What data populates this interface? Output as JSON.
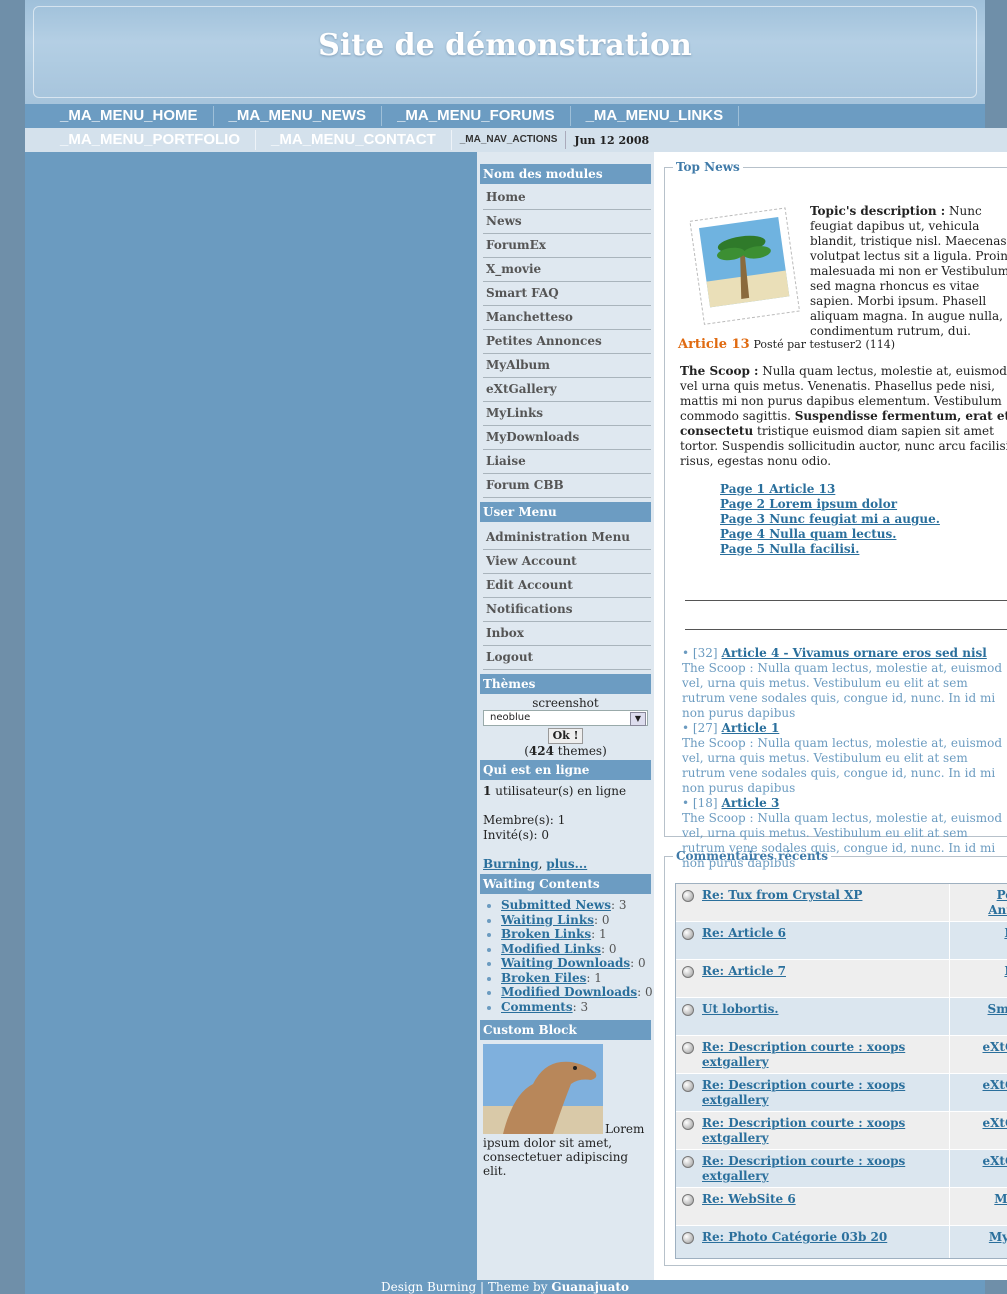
{
  "site": {
    "title": "Site de démonstration"
  },
  "nav": {
    "row1": [
      "_MA_MENU_HOME",
      "_MA_MENU_NEWS",
      "_MA_MENU_FORUMS",
      "_MA_MENU_LINKS"
    ],
    "row2": [
      "_MA_MENU_PORTFOLIO",
      "_MA_MENU_CONTACT"
    ],
    "actions": "_MA_NAV_ACTIONS",
    "date": "Jun 12 2008"
  },
  "modules": {
    "title": "Nom des modules",
    "items": [
      "Home",
      "News",
      "ForumEx",
      "X_movie",
      "Smart FAQ",
      "Manchetteso",
      "Petites Annonces",
      "MyAlbum",
      "eXtGallery",
      "MyLinks",
      "MyDownloads",
      "Liaise",
      "Forum CBB"
    ]
  },
  "usermenu": {
    "title": "User Menu",
    "items": [
      "Administration Menu",
      "View Account",
      "Edit Account",
      "Notifications",
      "Inbox",
      "Logout"
    ]
  },
  "themes": {
    "title": "Thèmes",
    "caption": "screenshot",
    "selected": "neoblue",
    "button": "Ok !",
    "count": "424",
    "count_suffix": "themes)",
    "count_prefix": "("
  },
  "online": {
    "title": "Qui est en ligne",
    "count": "1",
    "count_text": "utilisateur(s) en ligne",
    "members_label": "Membre(s):",
    "members": "1",
    "guests_label": "Invité(s):",
    "guests": "0",
    "link1": "Burning",
    "link2": "plus..."
  },
  "waiting": {
    "title": "Waiting Contents",
    "items": [
      {
        "label": "Submitted News",
        "value": "3"
      },
      {
        "label": "Waiting Links",
        "value": "0"
      },
      {
        "label": "Broken Links",
        "value": "1"
      },
      {
        "label": "Modified Links",
        "value": "0"
      },
      {
        "label": "Waiting Downloads",
        "value": "0"
      },
      {
        "label": "Broken Files",
        "value": "1"
      },
      {
        "label": "Modified Downloads",
        "value": "0"
      },
      {
        "label": "Comments",
        "value": "3"
      }
    ]
  },
  "custom": {
    "title": "Custom Block",
    "text": "Lorem ipsum dolor sit amet, consectetuer adipiscing elit."
  },
  "topnews": {
    "legend": "Top News",
    "desc_label": "Topic's description :",
    "desc_text": "Nunc feugiat dapibus ut, vehicula blandit, tristique nisl. Maecenas volutpat lectus sit a ligula. Proin malesuada mi non er Vestibulum sed magna rhoncus es vitae sapien. Morbi ipsum. Phasell aliquam magna. In augue nulla, u condimentum rutrum, dui.",
    "article_title": "Article 13",
    "posted": "Posté par testuser2 (114)",
    "scoop_label": "The Scoop :",
    "scoop_text": "Nulla quam lectus, molestie at, euismod vel urna quis metus. Venenatis. Phasellus pede nisi, mattis mi non purus dapibus elementum. Vestibulum commodo sagittis.",
    "scoop_bold": "Suspendisse fermentum, erat et consectetu",
    "scoop_text2": "tristique euismod diam sapien sit amet tortor. Suspendis sollicitudin auctor, nunc arcu facilisis risus, egestas nonu odio.",
    "pages": [
      "Page 1 Article 13",
      "Page 2 Lorem ipsum dolor",
      "Page 3 Nunc feugiat mi a augue.",
      "Page 4 Nulla quam lectus.",
      "Page 5 Nulla facilisi."
    ],
    "list": [
      {
        "count": "[32]",
        "title": "Article 4 - Vivamus ornare eros sed nisl",
        "text": "The Scoop : Nulla quam lectus, molestie at, euismod vel, urna quis metus. Vestibulum eu elit at sem rutrum vene sodales quis, congue id, nunc. In id mi non purus dapibus"
      },
      {
        "count": "[27]",
        "title": "Article 1",
        "text": "The Scoop : Nulla quam lectus, molestie at, euismod vel, urna quis metus. Vestibulum eu elit at sem rutrum vene sodales quis, congue id, nunc. In id mi non purus dapibus"
      },
      {
        "count": "[18]",
        "title": "Article 3",
        "text": "The Scoop : Nulla quam lectus, molestie at, euismod vel, urna quis metus. Vestibulum eu elit at sem rutrum vene sodales quis, congue id, nunc. In id mi non purus dapibus"
      }
    ]
  },
  "comments": {
    "legend": "Commentaires récents",
    "rows": [
      {
        "title": "Re: Tux from Crystal XP",
        "module": "Peti Anno"
      },
      {
        "title": "Re: Article 6",
        "module": "Ne"
      },
      {
        "title": "Re: Article 7",
        "module": "Ne"
      },
      {
        "title": "Ut lobortis.",
        "module": "Smar"
      },
      {
        "title": "Re: Description courte : xoops extgallery",
        "module": "eXtGa"
      },
      {
        "title": "Re: Description courte : xoops extgallery",
        "module": "eXtGa"
      },
      {
        "title": "Re: Description courte : xoops extgallery",
        "module": "eXtGa"
      },
      {
        "title": "Re: Description courte : xoops extgallery",
        "module": "eXtGa"
      },
      {
        "title": "Re: WebSite 6",
        "module": "MyL"
      },
      {
        "title": "Re: Photo Catégorie 03b 20",
        "module": "MyAl"
      }
    ]
  },
  "footer": {
    "text": "Design Burning | Theme by",
    "author": "Guanajuato"
  }
}
